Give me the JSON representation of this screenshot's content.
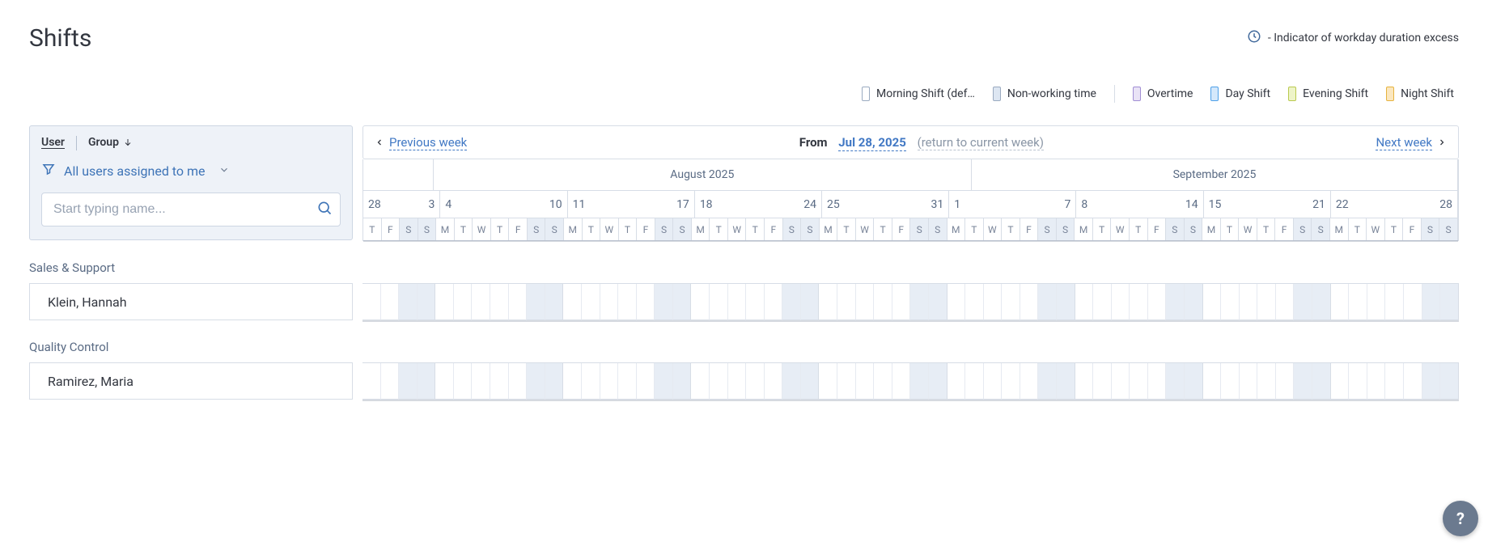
{
  "page": {
    "title": "Shifts",
    "indicator_label": " - Indicator of workday duration excess"
  },
  "legend": [
    {
      "label": "Morning Shift (def…",
      "bg": "#ffffff",
      "border": "#9aaac0"
    },
    {
      "label": "Non-working time",
      "bg": "#dde6f2",
      "border": "#9aaac0"
    },
    {
      "label": "Overtime",
      "bg": "#e9e3f6",
      "border": "#a18ed4"
    },
    {
      "label": "Day Shift",
      "bg": "#d4e8fb",
      "border": "#4ea0e8"
    },
    {
      "label": "Evening Shift",
      "bg": "#eef4c8",
      "border": "#b9c94e"
    },
    {
      "label": "Night Shift",
      "bg": "#fbe7bf",
      "border": "#e6b33e"
    }
  ],
  "sidebar": {
    "tabs": {
      "user": "User",
      "group": "Group"
    },
    "filter_label": "All users assigned to me",
    "search_placeholder": "Start typing name..."
  },
  "nav": {
    "prev": "Previous week",
    "from_label": "From",
    "date": "Jul 28, 2025",
    "return": "(return to current week)",
    "next": "Next week"
  },
  "months": [
    {
      "label": "August 2025",
      "span_days": 38
    },
    {
      "label": "September 2025",
      "span_days": 28
    }
  ],
  "month_blank_days": 4,
  "weeks": [
    {
      "start": "28",
      "end": "3",
      "first": true
    },
    {
      "start": "4",
      "end": "10"
    },
    {
      "start": "11",
      "end": "17"
    },
    {
      "start": "18",
      "end": "24"
    },
    {
      "start": "25",
      "end": "31"
    },
    {
      "start": "1",
      "end": "7"
    },
    {
      "start": "8",
      "end": "14"
    },
    {
      "start": "15",
      "end": "21"
    },
    {
      "start": "22",
      "end": "28"
    }
  ],
  "dow_seq": [
    "M",
    "T",
    "W",
    "T",
    "F",
    "S",
    "S"
  ],
  "dow_first": [
    "T",
    "F",
    "S",
    "S"
  ],
  "groups": [
    {
      "name": "Sales & Support",
      "people": [
        {
          "name": "Klein, Hannah"
        }
      ]
    },
    {
      "name": "Quality Control",
      "people": [
        {
          "name": "Ramirez, Maria"
        }
      ]
    }
  ],
  "help": "?"
}
